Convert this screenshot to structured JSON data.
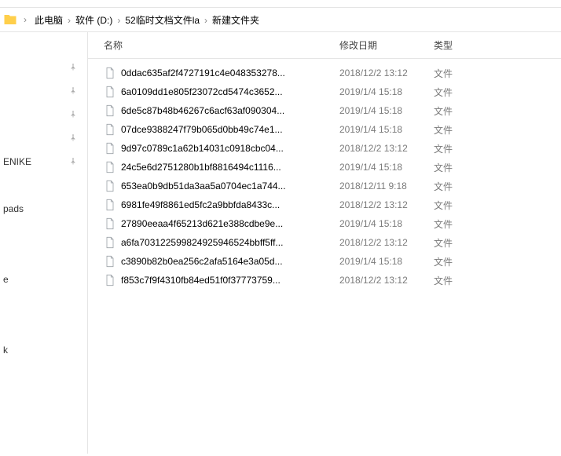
{
  "breadcrumb": {
    "items": [
      {
        "label": "此电脑"
      },
      {
        "label": "软件 (D:)"
      },
      {
        "label": "52临时文档文件la"
      },
      {
        "label": "新建文件夹"
      }
    ]
  },
  "columns": {
    "name": "名称",
    "date": "修改日期",
    "type": "类型"
  },
  "sidebar": {
    "items": [
      {
        "label": "",
        "pinned": true
      },
      {
        "label": "",
        "pinned": true
      },
      {
        "label": "",
        "pinned": true
      },
      {
        "label": "",
        "pinned": true
      },
      {
        "label": "ENIKE",
        "pinned": true
      },
      {
        "label": "",
        "pinned": false
      },
      {
        "label": "pads",
        "pinned": false
      },
      {
        "label": "",
        "pinned": false
      },
      {
        "label": "",
        "pinned": false
      },
      {
        "label": "e",
        "pinned": false
      },
      {
        "label": "",
        "pinned": false
      },
      {
        "label": "",
        "pinned": false
      },
      {
        "label": "k",
        "pinned": false
      }
    ]
  },
  "files": [
    {
      "name": "0ddac635af2f4727191c4e048353278...",
      "date": "2018/12/2 13:12",
      "type": "文件"
    },
    {
      "name": "6a0109dd1e805f23072cd5474c3652...",
      "date": "2019/1/4 15:18",
      "type": "文件"
    },
    {
      "name": "6de5c87b48b46267c6acf63af090304...",
      "date": "2019/1/4 15:18",
      "type": "文件"
    },
    {
      "name": "07dce9388247f79b065d0bb49c74e1...",
      "date": "2019/1/4 15:18",
      "type": "文件"
    },
    {
      "name": "9d97c0789c1a62b14031c0918cbc04...",
      "date": "2018/12/2 13:12",
      "type": "文件"
    },
    {
      "name": "24c5e6d2751280b1bf8816494c1116...",
      "date": "2019/1/4 15:18",
      "type": "文件"
    },
    {
      "name": "653ea0b9db51da3aa5a0704ec1a744...",
      "date": "2018/12/11 9:18",
      "type": "文件"
    },
    {
      "name": "6981fe49f8861ed5fc2a9bbfda8433c...",
      "date": "2018/12/2 13:12",
      "type": "文件"
    },
    {
      "name": "27890eeaa4f65213d621e388cdbe9e...",
      "date": "2019/1/4 15:18",
      "type": "文件"
    },
    {
      "name": "a6fa70312259982492594652​4bbff5ff...",
      "date": "2018/12/2 13:12",
      "type": "文件"
    },
    {
      "name": "c3890b82b0ea256c2afa5164e3a05d...",
      "date": "2019/1/4 15:18",
      "type": "文件"
    },
    {
      "name": "f853c7f9f4310fb84ed51f0f37773759...",
      "date": "2018/12/2 13:12",
      "type": "文件"
    }
  ]
}
